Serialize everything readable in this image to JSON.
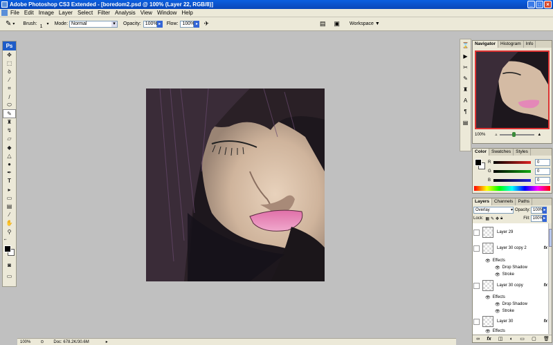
{
  "window": {
    "title": "Adobe Photoshop CS3 Extended - [boredom2.psd @ 100% (Layer 22, RGB/8)]"
  },
  "menu": [
    "File",
    "Edit",
    "Image",
    "Layer",
    "Select",
    "Filter",
    "Analysis",
    "View",
    "Window",
    "Help"
  ],
  "options": {
    "brush_label": "Brush:",
    "brush_size": "1",
    "mode_label": "Mode:",
    "mode_value": "Normal",
    "opacity_label": "Opacity:",
    "opacity_value": "100%",
    "flow_label": "Flow:",
    "flow_value": "100%",
    "workspace_label": "Workspace ▼"
  },
  "toolbox": {
    "logo": "Ps"
  },
  "status": {
    "zoom": "100%",
    "doc": "Doc: 678.2K/30.6M"
  },
  "navigator": {
    "tabs": [
      "Navigator",
      "Histogram",
      "Info"
    ],
    "zoom": "100%"
  },
  "color": {
    "tabs": [
      "Color",
      "Swatches",
      "Styles"
    ],
    "channels": [
      {
        "label": "R",
        "value": "0",
        "color": "#d22"
      },
      {
        "label": "G",
        "value": "0",
        "color": "#1a1"
      },
      {
        "label": "B",
        "value": "0",
        "color": "#22d"
      }
    ]
  },
  "layers": {
    "tabs": [
      "Layers",
      "Channels",
      "Paths"
    ],
    "blend_mode": "Overlay",
    "opacity_label": "Opacity:",
    "opacity_value": "100%",
    "lock_label": "Lock:",
    "fill_label": "Fill:",
    "fill_value": "100%",
    "rows": [
      {
        "name": "Layer 29"
      },
      {
        "name": "Layer 30 copy 2",
        "fx": "fx"
      },
      {
        "name": "Layer 30 copy",
        "fx": "fx"
      },
      {
        "name": "Layer 30",
        "fx": "fx"
      }
    ],
    "effects_label": "Effects",
    "drop_shadow": "Drop Shadow",
    "stroke": "Stroke"
  }
}
